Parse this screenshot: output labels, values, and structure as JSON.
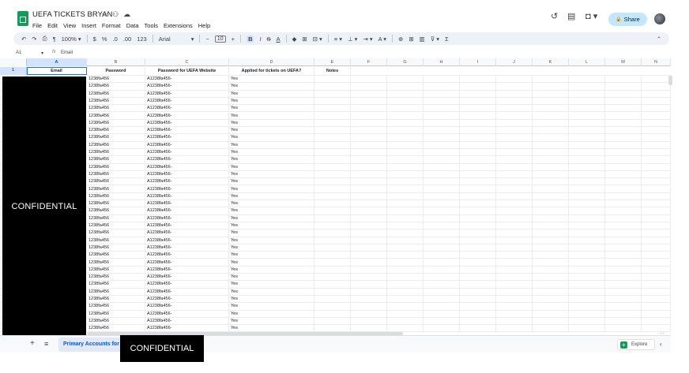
{
  "doc": {
    "title": "UEFA TICKETS BRYAN",
    "title_icons": [
      "☆",
      "⚇",
      "☁"
    ],
    "menu": [
      "File",
      "Edit",
      "View",
      "Insert",
      "Format",
      "Data",
      "Tools",
      "Extensions",
      "Help"
    ]
  },
  "header_actions": {
    "history_icon": "↺",
    "comment_icon": "▤",
    "meet_icon": "◘ ▾",
    "share_label": "Share",
    "share_icon": "🔒"
  },
  "toolbar": {
    "undo": "↶",
    "redo": "↷",
    "print": "⎙",
    "paint_format": "¶",
    "zoom": "100% ▾",
    "currency": "$",
    "percent": "%",
    "decrease_decimal": ".0",
    "increase_decimal": ".00",
    "number_format": "123",
    "font": "Arial",
    "font_chevron": "▾",
    "font_size_minus": "−",
    "font_size": "10",
    "font_size_plus": "+",
    "bold": "B",
    "italic": "I",
    "strike": "S",
    "text_color": "A",
    "fill": "◆",
    "borders": "⊞",
    "merge": "⊟ ▾",
    "h_align": "≡ ▾",
    "v_align": "⊥ ▾",
    "wrap": "⇥ ▾",
    "rotate": "A ▾",
    "link": "⊕",
    "comment": "⊞",
    "chart": "▥",
    "filter": "⊽ ▾",
    "functions": "Σ",
    "collapse": "⌃"
  },
  "formula_bar": {
    "name_box": "A1",
    "name_box_arrow": "▾",
    "fx": "fx",
    "value": "Email"
  },
  "grid": {
    "columns": [
      "A",
      "B",
      "C",
      "D",
      "E",
      "F",
      "G",
      "H",
      "I",
      "J",
      "K",
      "L",
      "M",
      "N"
    ],
    "selected_column": "A",
    "header_row": {
      "number": "1",
      "cells": [
        "Email",
        "Password",
        "Password for UEFA Website",
        "Applied for tickets on UEFA?",
        "Notes"
      ]
    },
    "data_rows": [
      {
        "b": "1238fa456",
        "c": "A1238fa456-",
        "d": "Yes"
      },
      {
        "b": "1238fa456",
        "c": "A1238fa456-",
        "d": "Yes"
      },
      {
        "b": "1238fa456",
        "c": "A1238fa456-",
        "d": "Yes"
      },
      {
        "b": "1238fa456",
        "c": "A1238fa456-",
        "d": "Yes"
      },
      {
        "b": "1238fa456",
        "c": "A1238fa456-",
        "d": "Yes"
      },
      {
        "b": "1238fa456",
        "c": "A1238fa456-",
        "d": "Yes"
      },
      {
        "b": "1238fa456",
        "c": "A1238fa456-",
        "d": "Yes"
      },
      {
        "b": "1238fa456",
        "c": "A1238fa456-",
        "d": "Yes"
      },
      {
        "b": "1238fa456",
        "c": "A1238fa456-",
        "d": "Yes"
      },
      {
        "b": "1238fa456",
        "c": "A1238fa456-",
        "d": "Yes"
      },
      {
        "b": "1238fa456",
        "c": "A1238fa456-",
        "d": "Yes"
      },
      {
        "b": "1238fa456",
        "c": "A1238fa456-",
        "d": "Yes"
      },
      {
        "b": "1238fa456",
        "c": "A1238fa456-",
        "d": "Yes"
      },
      {
        "b": "1238fa456",
        "c": "A1238fa456-",
        "d": "Yes"
      },
      {
        "b": "1238fa456",
        "c": "A1238fa456-",
        "d": "Yes"
      },
      {
        "b": "1238fa456",
        "c": "A1238fa456-",
        "d": "Yes"
      },
      {
        "b": "1238fa456",
        "c": "A1238fa456-",
        "d": "Yes"
      },
      {
        "b": "1238fa456",
        "c": "A1238fa456-",
        "d": "Yes"
      },
      {
        "b": "1238fa456",
        "c": "A1238fa456-",
        "d": "Yes"
      },
      {
        "b": "1238fa456",
        "c": "A1238fa456-",
        "d": "Yes"
      },
      {
        "b": "1238fa456",
        "c": "A1238fa456-",
        "d": "Yes"
      },
      {
        "b": "1238fa456",
        "c": "A1238fa456-",
        "d": "Yes"
      },
      {
        "b": "1238fa456",
        "c": "A1238fa456-",
        "d": "Yes"
      },
      {
        "b": "1238fa456",
        "c": "A1238fa456-",
        "d": "Yes"
      },
      {
        "b": "1238fa456",
        "c": "A1238fa456-",
        "d": "Yes"
      },
      {
        "b": "1238fa456",
        "c": "A1238fa456-",
        "d": "Yes"
      },
      {
        "b": "1238fa456",
        "c": "A1238fa456-",
        "d": "Yes"
      },
      {
        "b": "1238fa456",
        "c": "A1238fa456-",
        "d": "Yes"
      },
      {
        "b": "1238fa456",
        "c": "A1238fa456-",
        "d": "Yes"
      },
      {
        "b": "1238fa456",
        "c": "A1238fa456-",
        "d": "Yes"
      },
      {
        "b": "1238fa456",
        "c": "A1238fa456-",
        "d": "Yes"
      },
      {
        "b": "1238fa456",
        "c": "A1238fa456-",
        "d": "Yes"
      },
      {
        "b": "1238fa456",
        "c": "A1238fa456-",
        "d": "Yes"
      },
      {
        "b": "1238fa456",
        "c": "A1238fa456-",
        "d": "Yes"
      },
      {
        "b": "1238fa456",
        "c": "A1238fa456-",
        "d": "Yes"
      }
    ]
  },
  "redactions": {
    "left_label": "CONFIDENTIAL",
    "tab_label": "CONFIDENTIAL"
  },
  "bottom": {
    "add_sheet": "+",
    "all_sheets": "≡",
    "sheet_tab": "Primary Accounts for UEFA",
    "explore_label": "Explore",
    "explore_icon": "+",
    "side_chevron": "‹",
    "scroll_arrows": "‹ ›"
  },
  "colors": {
    "accent": "#0b57d0",
    "share_bg": "#c2e7ff",
    "sheets_green": "#0f9d58",
    "toolbar_bg": "#eef2f8"
  }
}
